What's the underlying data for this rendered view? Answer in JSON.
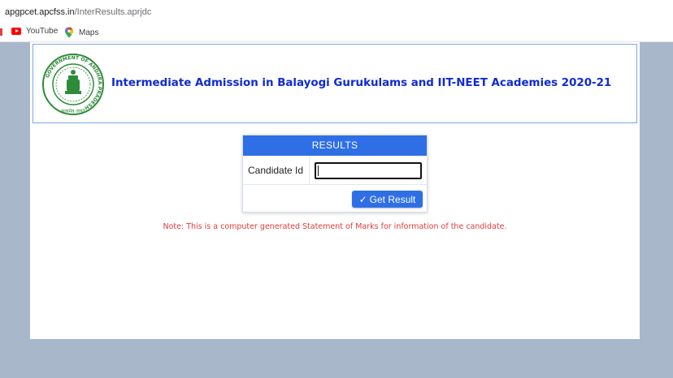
{
  "browser": {
    "url_host": "apgpcet.apcfss.in",
    "url_path": "/InterResults.aprjdc",
    "bookmarks": [
      {
        "label": "YouTube",
        "icon": "youtube-icon"
      },
      {
        "label": "Maps",
        "icon": "maps-icon"
      }
    ]
  },
  "header": {
    "title": "Intermediate Admission in Balayogi Gurukulams and IIT-NEET Academies 2020-21",
    "emblem_text_top": "GOVERNMENT OF ANDHRA PRADESH",
    "emblem_text_bottom": "सत्यमेव जयते"
  },
  "results": {
    "heading": "RESULTS",
    "candidate_label": "Candidate Id",
    "candidate_value": "",
    "button_check": "✓",
    "button_label": "Get Result"
  },
  "note": "Note: This is a computer generated Statement of Marks for information of the candidate.",
  "colors": {
    "page_bg": "#a9b7cb",
    "accent": "#2f6fe6",
    "title": "#0f2ad6",
    "note": "#e03a3a",
    "emblem_green": "#2e8b3a"
  }
}
